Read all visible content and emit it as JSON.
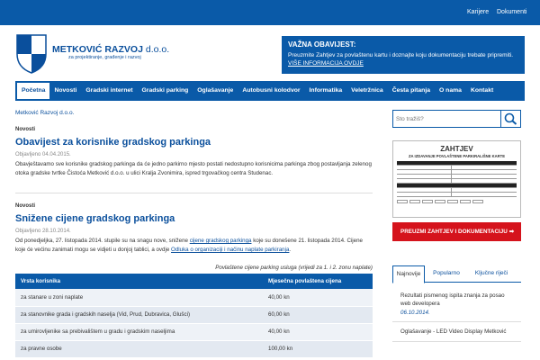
{
  "topbar": {
    "links": [
      "Karijere",
      "Dokumenti"
    ]
  },
  "logo": {
    "name": "METKOVIĆ RAZVOJ",
    "suffix": "d.o.o.",
    "tagline": "za projektiranje, građenje i razvoj"
  },
  "notice": {
    "title": "VAŽNA OBAVIJEST:",
    "text": "Preuzmite Zahtjev za povlaštenu kartu i doznajte koju dokumentaciju trebate pripremiti.",
    "link": "VIŠE INFORMACIJA OVDJE"
  },
  "nav": [
    "Početna",
    "Novosti",
    "Gradski internet",
    "Gradski parking",
    "Oglašavanje",
    "Autobusni kolodvor",
    "Informatika",
    "Veletržnica",
    "Česta pitanja",
    "O nama",
    "Kontakt"
  ],
  "breadcrumb": "Metković Razvoj d.o.o.",
  "articles": [
    {
      "category": "Novosti",
      "title": "Obavijest za korisnike gradskog parkinga",
      "date": "Objavljeno 04.04.2015.",
      "body": "Obavještavamo sve korisnike gradskog parkinga da će jedno parkirno mjesto postati nedostupno korisnicima parkinga zbog postavljanja zelenog otoka gradske tvrtke Čistoća Metković d.o.o. u ulici Kralja Zvonimira, ispred trgovačkog centra Studenac."
    },
    {
      "category": "Novosti",
      "title": "Snižene cijene gradskog parkinga",
      "date": "Objavljeno 28.10.2014.",
      "body_1": "Od ponedjeljka, 27. listopada 2014. stupile su na snagu nove, snižene",
      "link_1": "cijene gradskog parkinga",
      "body_2": "koje su donešene 21. listopada 2014. Cijene koje će većinu zanimati mogu se vidjeti u donjoj tablici, a ovdje",
      "link_2": "Odluka o organizaciji i načinu naplate parkiranja",
      "body_3": "."
    }
  ],
  "price_table": {
    "caption": "Povlaštene cijene parking usluga (vrijedi za 1. i 2. zonu naplate)",
    "headers": [
      "Vrsta korisnika",
      "Mjesečna povlaštena cijena"
    ],
    "rows": [
      [
        "za stanare u zoni naplate",
        "40,00 kn"
      ],
      [
        "za stanovnike grada i gradskih naselja (Vid, Prud, Dubravica, Glušci)",
        "60,00 kn"
      ],
      [
        "za umirovljenike sa prebivalištem u gradu i gradskim naseljima",
        "40,00 kn"
      ],
      [
        "za pravne osobe",
        "100,00 kn"
      ]
    ]
  },
  "search": {
    "placeholder": "Što tražiš?"
  },
  "form_preview": {
    "title": "ZAHTJEV",
    "subtitle": "ZA IZDAVANJE POVLAŠTENE PARKIRALIŠNE KARTE"
  },
  "cta": {
    "label": "PREUZMI ZAHTJEV I DOKUMENTACIJU"
  },
  "tabs": [
    "Najnovije",
    "Popularno",
    "Ključne riječi"
  ],
  "news": [
    {
      "title": "Rezultati pismenog ispita znanja za posao web developera",
      "date": "06.10.2014."
    },
    {
      "title": "Oglašavanje - LED Video Display Metković",
      "date": ""
    }
  ],
  "colors": {
    "brand_blue": "#0a5aa8",
    "accent_red": "#d5131c"
  }
}
